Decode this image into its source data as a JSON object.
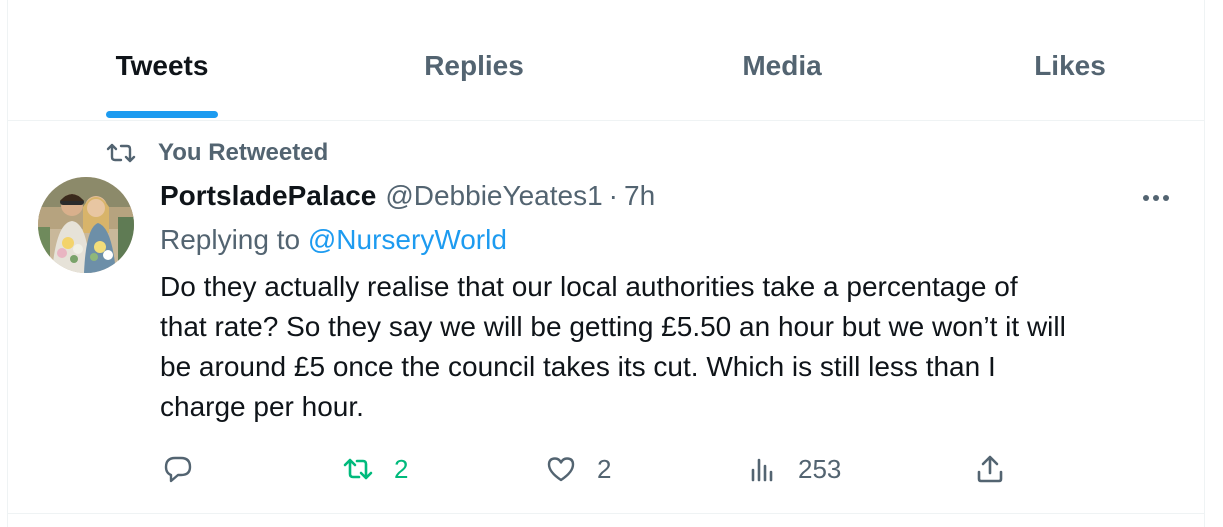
{
  "tabs": [
    {
      "label": "Tweets",
      "active": true
    },
    {
      "label": "Replies",
      "active": false
    },
    {
      "label": "Media",
      "active": false
    },
    {
      "label": "Likes",
      "active": false
    }
  ],
  "tweet": {
    "retweet_context": "You Retweeted",
    "display_name": "PortsladePalace",
    "handle": "@DebbieYeates1",
    "separator": "·",
    "time": "7h",
    "replying_to_prefix": "Replying to",
    "replying_to_mention": "@NurseryWorld",
    "text_lines": [
      "Do they actually realise that our local authorities take a percentage of",
      "that rate? So they say we will be getting £5.50 an hour but we won’t it will",
      "be around £5 once the council takes its cut. Which is still less than I",
      "charge per hour."
    ],
    "actions": {
      "reply": {
        "icon": "reply-icon",
        "count": ""
      },
      "retweet": {
        "icon": "retweet-icon",
        "count": "2",
        "active": true
      },
      "like": {
        "icon": "heart-icon",
        "count": "2"
      },
      "views": {
        "icon": "analytics-icon",
        "count": "253"
      },
      "share": {
        "icon": "share-icon",
        "count": ""
      }
    }
  },
  "colors": {
    "accent": "#1d9bf0",
    "retweet_active": "#00ba7c",
    "secondary_text": "#536471",
    "primary_text": "#0f1419",
    "border": "#eff3f4"
  }
}
